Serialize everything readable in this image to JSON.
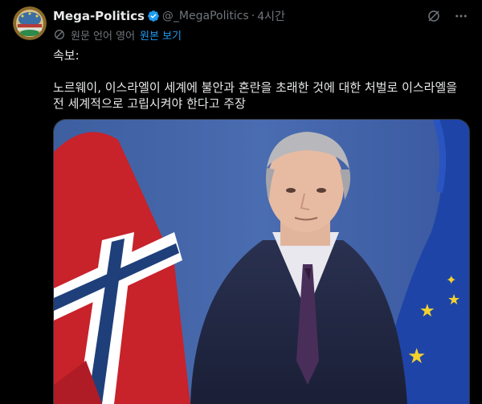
{
  "tweet": {
    "display_name": "Mega-Politics",
    "handle": "@_MegaPolitics",
    "separator": "·",
    "time": "4시간",
    "translation": {
      "label": "원문 언어 영어",
      "link": "원본 보기"
    },
    "text_line1": "속보:",
    "text_line2": "노르웨이, 이스라엘이 세계에 불안과 혼란을 초래한 것에 대한 처벌로 이스라엘을 전 세계적으로 고립시켜야 한다고 주장"
  },
  "icons": {
    "verified": "verified-badge-icon",
    "grok": "grok-icon",
    "more": "more-icon",
    "translate": "translate-icon"
  },
  "colors": {
    "background": "#000000",
    "text": "#e7e9ea",
    "secondary": "#71767b",
    "accent": "#1d9bf0"
  }
}
